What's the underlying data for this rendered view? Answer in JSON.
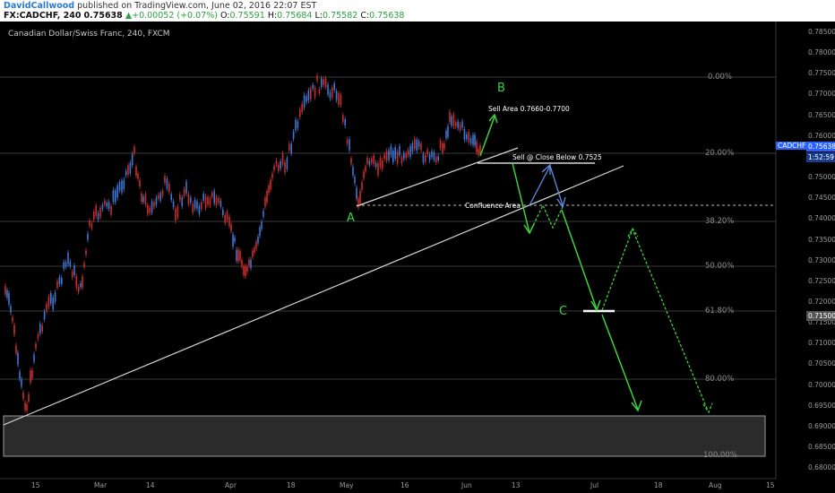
{
  "header": {
    "author": "DavidCallwood",
    "published": " published on TradingView.com, June 02, 2016 22:07 EST",
    "symbol": "FX:CADCHF, 240",
    "last": "0.75638",
    "change": "▲+0.00052 (+0.07%)",
    "o_label": "O:",
    "o_value": "0.75591",
    "h_label": "H:",
    "h_value": "0.75684",
    "l_label": "L:",
    "l_value": "0.75582",
    "c_label": "C:",
    "c_value": "0.75638"
  },
  "chart": {
    "title": "Canadian Dollar/Swiss Franc, 240, FXCM",
    "price_axis": [
      "0.78500",
      "0.78000",
      "0.77500",
      "0.77000",
      "0.76500",
      "0.76000",
      "0.75500",
      "0.75000",
      "0.74500",
      "0.74000",
      "0.73500",
      "0.73000",
      "0.72500",
      "0.72000",
      "0.71500",
      "0.71000",
      "0.70500",
      "0.70000",
      "0.69500",
      "0.69000",
      "0.68500",
      "0.68000"
    ],
    "time_axis": [
      "15",
      "Mar",
      "14",
      "Apr",
      "18",
      "May",
      "16",
      "Jun",
      "13",
      "Jul",
      "18",
      "Aug",
      "15"
    ],
    "symbol_tag": "CADCHF",
    "price_tag": "0.75638",
    "countdown_tag": "1:52:59",
    "level_tag": "0.71500",
    "fib_levels": [
      "0.00%",
      "20.00%",
      "38.20%",
      "50.00%",
      "61.80%",
      "80.00%",
      "100.00%"
    ],
    "annotations": {
      "sell_area": "Sell Area 0.7660-0.7700",
      "sell_close": "Sell @ Close Below 0.7525",
      "confluence": "Confluence Area"
    },
    "waves": {
      "a": "A",
      "b": "B",
      "c": "C"
    },
    "colors": {
      "background": "#000000",
      "bull_candle": "#3c78d8",
      "bear_candle": "#cc2b2b",
      "projection": "#3bd43b",
      "blue_arrow": "#5b8fe6"
    }
  }
}
